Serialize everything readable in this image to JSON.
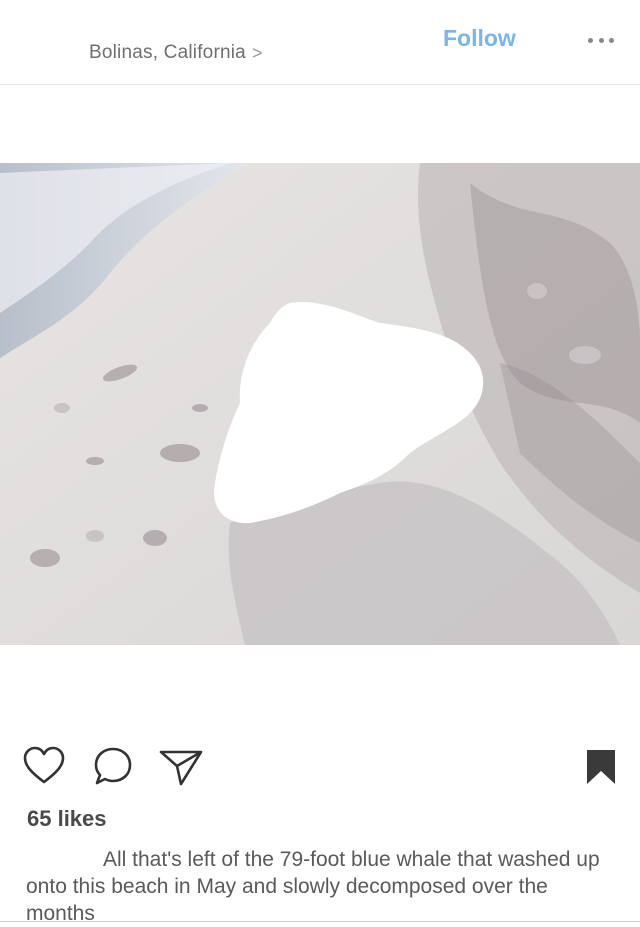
{
  "header": {
    "location": "Bolinas, California",
    "location_chevron": ">",
    "follow_label": "Follow",
    "more_icon": "more-horizontal-icon"
  },
  "post": {
    "photo_alt": "",
    "likes": "65 likes",
    "caption": "All that's left of the 79-foot blue whale that washed up onto this beach in May and slowly decomposed over the months"
  },
  "actions": {
    "icons": [
      "heart-icon",
      "comment-icon",
      "share-icon",
      "bookmark-icon"
    ]
  },
  "colors": {
    "follow": "#7bb4ea",
    "text": "#262626",
    "muted": "#6f6f6f"
  }
}
